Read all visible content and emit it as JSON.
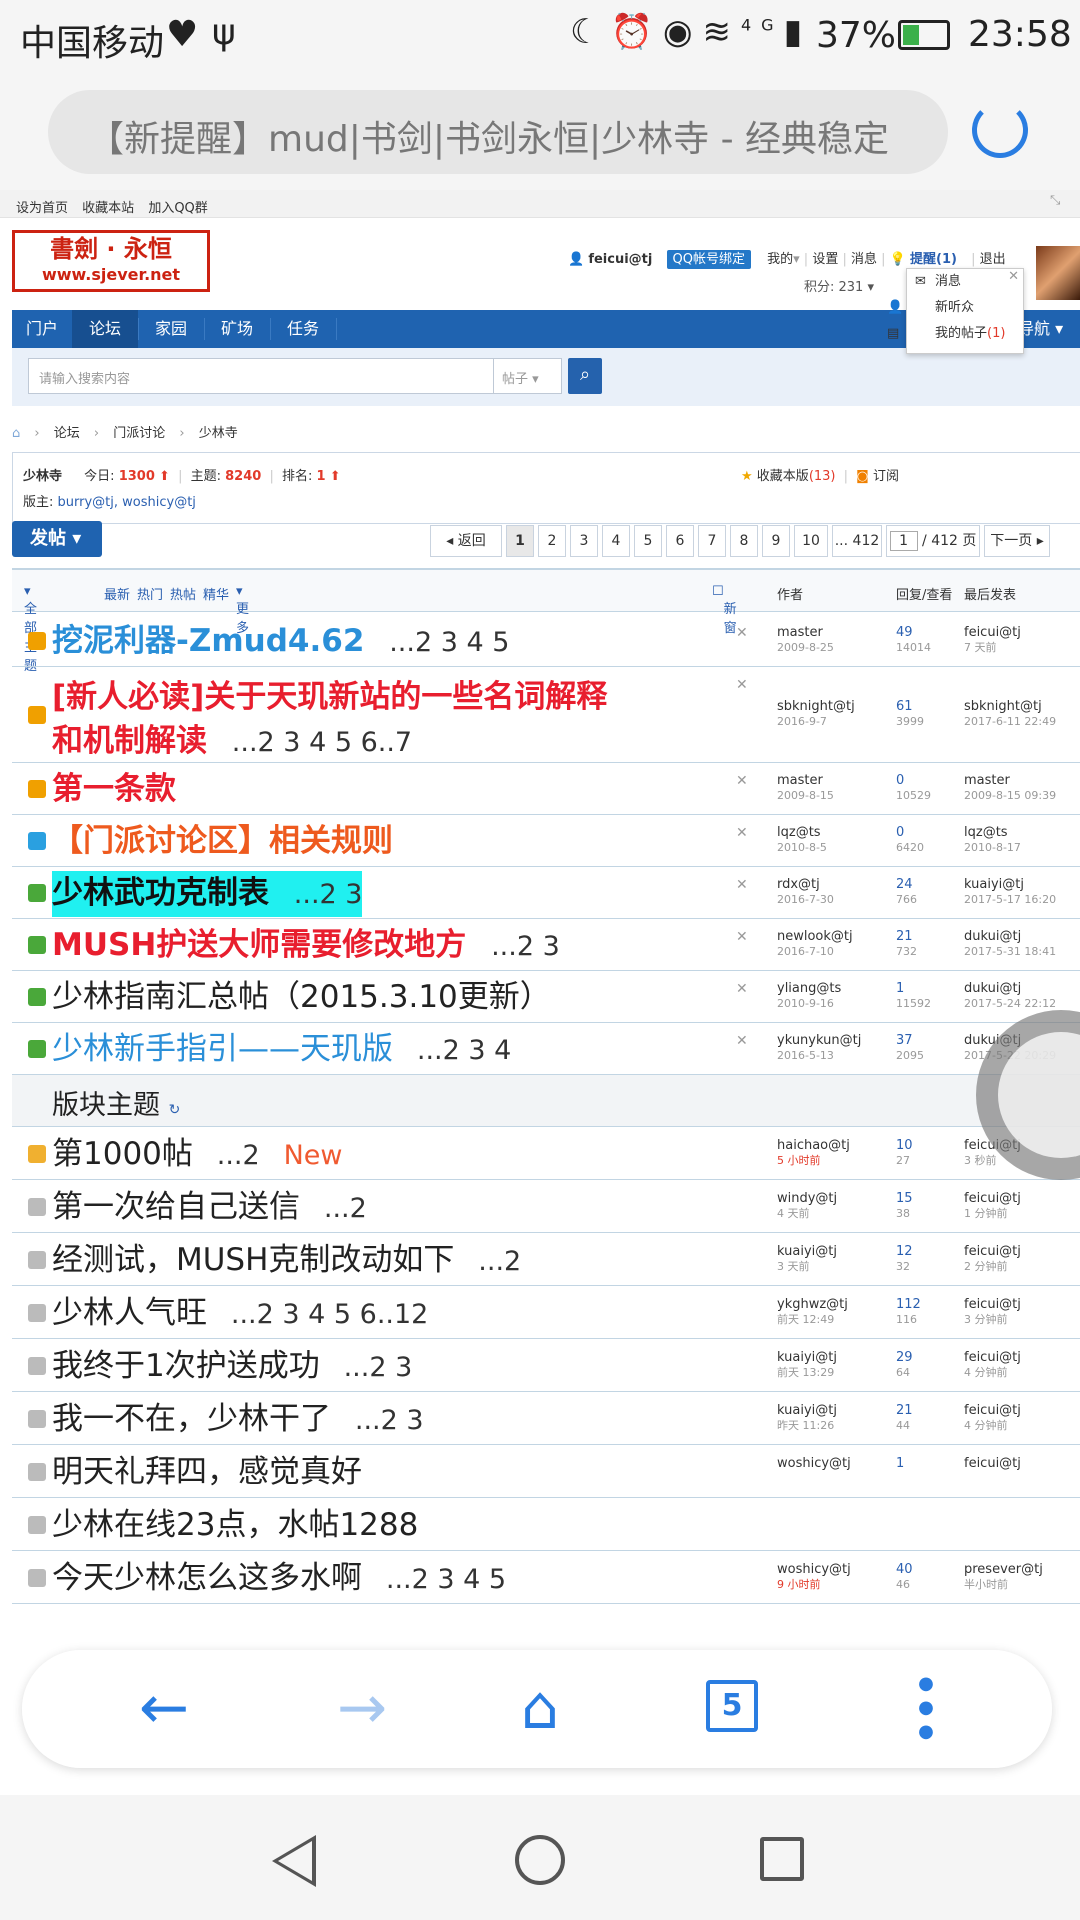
{
  "status": {
    "carrier": "中国移动",
    "network": "4G",
    "battery": "37%",
    "time": "23:58"
  },
  "browser": {
    "url_title": "【新提醒】mud|书剑|书剑永恒|少林寺 - 经典稳定",
    "tab_count": "5"
  },
  "site": {
    "top_links": [
      "设为首页",
      "收藏本站",
      "加入QQ群"
    ],
    "logo_line1": "書劍 · 永恒",
    "logo_line2": "www.sjever.net",
    "username": "feicui@tj",
    "qq_bind": "QQ帐号绑定",
    "user_links": {
      "mine": "我的",
      "settings": "设置",
      "messages": "消息",
      "remind": "提醒(1)",
      "logout": "退出"
    },
    "score": "积分: 231",
    "popup": {
      "msg": "消息",
      "listeners": "新听众",
      "my_posts": "我的帖子",
      "my_posts_count": "(1)"
    },
    "nav": {
      "items": [
        "门户",
        "论坛",
        "家园",
        "矿场",
        "任务"
      ],
      "right": "导航"
    },
    "search": {
      "placeholder": "请输入搜索内容",
      "scope": "帖子"
    },
    "breadcrumb": [
      "论坛",
      "门派讨论",
      "少林寺"
    ]
  },
  "forum": {
    "name": "少林寺",
    "today_label": "今日:",
    "today": "1300",
    "topics_label": "主题:",
    "topics": "8240",
    "rank_label": "排名:",
    "rank": "1",
    "moderators_label": "版主:",
    "moderators": "burry@tj, woshicy@tj",
    "favorite": "收藏本版",
    "favorite_count": "(13)",
    "subscribe": "订阅"
  },
  "toolbar": {
    "post": "发帖",
    "back": "返回",
    "pages": [
      "1",
      "2",
      "3",
      "4",
      "5",
      "6",
      "7",
      "8",
      "9",
      "10",
      "... 412"
    ],
    "page_input": "1",
    "page_total": "/ 412 页",
    "next": "下一页"
  },
  "list_header": {
    "filters": [
      "全部主题",
      "最新",
      "热门",
      "热帖",
      "精华",
      "更多"
    ],
    "new_window": "新窗",
    "author": "作者",
    "reply_view": "回复/查看",
    "last_post": "最后发表"
  },
  "sticky": [
    {
      "title": "挖泥利器-Zmud4.62",
      "pages": "...2 3 4 5",
      "color": "#2a8fd8",
      "author": "master",
      "date": "2009-8-25",
      "replies": "49",
      "views": "14014",
      "last_user": "feicui@tj",
      "last_time": "7 天前"
    },
    {
      "title": "[新人必读]关于天玑新站的一些名词解释",
      "title2": "和机制解读",
      "pages": "...2 3 4 5 6..7",
      "color": "#e81e2e",
      "author": "sbknight@tj",
      "date": "2016-9-7",
      "replies": "61",
      "views": "3999",
      "last_user": "sbknight@tj",
      "last_time": "2017-6-11 22:49"
    },
    {
      "title": "第一条款",
      "pages": "",
      "color": "#e81e2e",
      "author": "master",
      "date": "2009-8-15",
      "replies": "0",
      "views": "10529",
      "last_user": "master",
      "last_time": "2009-8-15 09:39"
    },
    {
      "title": "【门派讨论区】相关规则",
      "pages": "",
      "color": "#ee5a1e",
      "author": "lqz@ts",
      "date": "2010-8-5",
      "replies": "0",
      "views": "6420",
      "last_user": "lqz@ts",
      "last_time": "2010-8-17"
    },
    {
      "title": "少林武功克制表",
      "pages": "...2 3",
      "color": "#111111",
      "author": "rdx@tj",
      "date": "2016-7-30",
      "replies": "24",
      "views": "766",
      "last_user": "kuaiyi@tj",
      "last_time": "2017-5-17 16:20"
    },
    {
      "title": "MUSH护送大师需要修改地方",
      "pages": "...2 3",
      "color": "#e81e2e",
      "author": "newlook@tj",
      "date": "2016-7-10",
      "replies": "21",
      "views": "732",
      "last_user": "dukui@tj",
      "last_time": "2017-5-31 18:41"
    },
    {
      "title": "少林指南汇总帖（2015.3.10更新）",
      "pages": "",
      "color": "#222222",
      "author": "yliang@ts",
      "date": "2010-9-16",
      "replies": "1",
      "views": "11592",
      "last_user": "dukui@tj",
      "last_time": "2017-5-24 22:12"
    },
    {
      "title": "少林新手指引——天玑版",
      "pages": "...2 3 4",
      "color": "#2a8fd8",
      "author": "ykunykun@tj",
      "date": "2016-5-13",
      "replies": "37",
      "views": "2095",
      "last_user": "dukui@tj",
      "last_time": "2017-5-22 20:29"
    }
  ],
  "section_title": "版块主题",
  "threads": [
    {
      "title": "第1000帖",
      "pages": "...2",
      "new": "New",
      "author": "haichao@tj",
      "date": "5 小时前",
      "date_red": true,
      "replies": "10",
      "views": "27",
      "last_user": "feicui@tj",
      "last_time": "3 秒前"
    },
    {
      "title": "第一次给自己送信",
      "pages": "...2",
      "new": "",
      "author": "windy@tj",
      "date": "4 天前",
      "date_red": false,
      "replies": "15",
      "views": "38",
      "last_user": "feicui@tj",
      "last_time": "1 分钟前"
    },
    {
      "title": "经测试，MUSH克制改动如下",
      "pages": "...2",
      "new": "",
      "author": "kuaiyi@tj",
      "date": "3 天前",
      "date_red": false,
      "replies": "12",
      "views": "32",
      "last_user": "feicui@tj",
      "last_time": "2 分钟前"
    },
    {
      "title": "少林人气旺",
      "pages": "...2 3 4 5 6..12",
      "new": "",
      "author": "ykghwz@tj",
      "date": "前天 12:49",
      "date_red": false,
      "replies": "112",
      "views": "116",
      "last_user": "feicui@tj",
      "last_time": "3 分钟前"
    },
    {
      "title": "我终于1次护送成功",
      "pages": "...2 3",
      "new": "",
      "author": "kuaiyi@tj",
      "date": "前天 13:29",
      "date_red": false,
      "replies": "29",
      "views": "64",
      "last_user": "feicui@tj",
      "last_time": "4 分钟前"
    },
    {
      "title": "我一不在，少林干了",
      "pages": "...2 3",
      "new": "",
      "author": "kuaiyi@tj",
      "date": "昨天 11:26",
      "date_red": false,
      "replies": "21",
      "views": "44",
      "last_user": "feicui@tj",
      "last_time": "4 分钟前"
    },
    {
      "title": "明天礼拜四，感觉真好",
      "pages": "",
      "new": "",
      "author": "woshicy@tj",
      "date": "",
      "date_red": false,
      "replies": "1",
      "views": "",
      "last_user": "feicui@tj",
      "last_time": ""
    },
    {
      "title": "少林在线23点，水帖1288",
      "pages": "",
      "new": "",
      "author": "",
      "date": "",
      "date_red": false,
      "replies": "",
      "views": "",
      "last_user": "",
      "last_time": ""
    },
    {
      "title": "今天少林怎么这多水啊",
      "pages": "...2 3 4 5",
      "new": "",
      "author": "woshicy@tj",
      "date": "9 小时前",
      "date_red": true,
      "replies": "40",
      "views": "46",
      "last_user": "presever@tj",
      "last_time": "半小时前"
    }
  ],
  "colors": {
    "accent": "#2a7de1",
    "nav": "#1f63b0",
    "red": "#e23a2a",
    "link": "#2a5fb0"
  }
}
